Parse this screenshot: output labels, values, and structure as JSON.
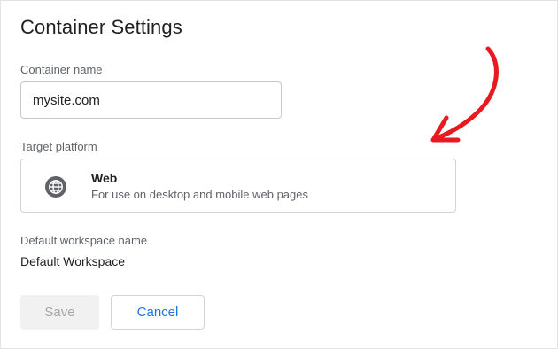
{
  "dialog": {
    "title": "Container Settings"
  },
  "container_name": {
    "label": "Container name",
    "value": "mysite.com"
  },
  "target_platform": {
    "label": "Target platform",
    "option": {
      "name": "Web",
      "description": "For use on desktop and mobile web pages",
      "icon": "globe-icon"
    }
  },
  "workspace": {
    "label": "Default workspace name",
    "value": "Default Workspace"
  },
  "buttons": {
    "save": "Save",
    "cancel": "Cancel"
  },
  "annotation": {
    "icon": "red-arrow-annotation",
    "color": "#e8191f"
  },
  "colors": {
    "accent": "#1a73e8",
    "icon_gray": "#5f6368"
  }
}
